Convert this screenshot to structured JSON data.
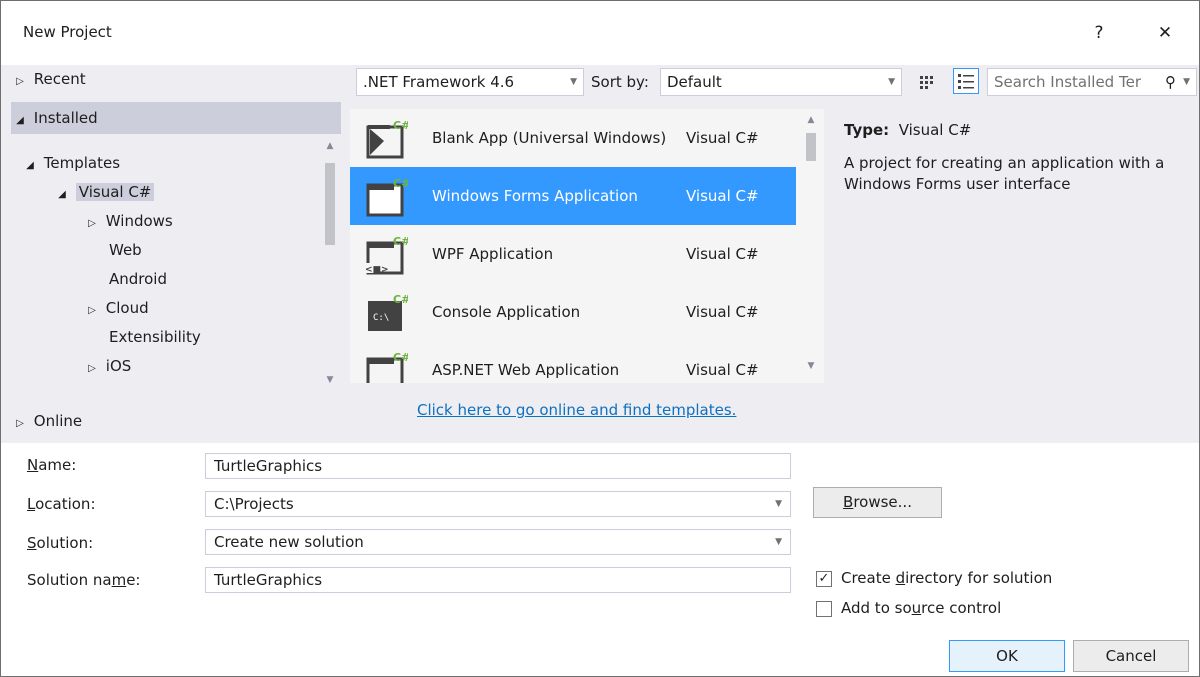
{
  "window": {
    "title": "New Project",
    "help_glyph": "?",
    "close_glyph": "✕"
  },
  "left_tree": {
    "recent": "Recent",
    "installed": "Installed",
    "templates": "Templates",
    "visual_csharp": "Visual C#",
    "children": [
      "Windows",
      "Web",
      "Android",
      "Cloud",
      "Extensibility",
      "iOS"
    ],
    "online": "Online"
  },
  "toolbar": {
    "framework": ".NET Framework 4.6",
    "sort_label": "Sort by:",
    "sort_value": "Default",
    "search_placeholder": "Search Installed Ter"
  },
  "templates": [
    {
      "name": "Blank App (Universal Windows)",
      "lang": "Visual C#",
      "icon": "blank-app-icon",
      "badge": "C#"
    },
    {
      "name": "Windows Forms Application",
      "lang": "Visual C#",
      "icon": "windows-forms-icon",
      "badge": "C#"
    },
    {
      "name": "WPF Application",
      "lang": "Visual C#",
      "icon": "wpf-icon",
      "badge": "C#"
    },
    {
      "name": "Console Application",
      "lang": "Visual C#",
      "icon": "console-icon",
      "badge": "C#",
      "console_text": "C:\\"
    },
    {
      "name": "ASP.NET Web Application",
      "lang": "Visual C#",
      "icon": "aspnet-icon",
      "badge": "C#"
    }
  ],
  "details": {
    "type_label": "Type:",
    "type_value": "Visual C#",
    "description": "A project for creating an application with a Windows Forms user interface"
  },
  "online_link": "Click here to go online and find templates.",
  "form": {
    "name_label_u": "N",
    "name_label_rest": "ame:",
    "name_value": "TurtleGraphics",
    "location_label_u": "L",
    "location_label_rest": "ocation:",
    "location_value": "C:\\Projects",
    "solution_label_u": "S",
    "solution_label_rest": "olution:",
    "solution_value": "Create new solution",
    "solution_name_label_a": "Solution na",
    "solution_name_label_u": "m",
    "solution_name_label_b": "e:",
    "solution_name_value": "TurtleGraphics",
    "browse_u": "B",
    "browse_rest": "rowse...",
    "create_dir_a": "Create ",
    "create_dir_u": "d",
    "create_dir_b": "irectory for solution",
    "create_dir_checked": true,
    "source_a": "Add to so",
    "source_u": "u",
    "source_b": "rce control",
    "source_checked": false,
    "ok": "OK",
    "cancel": "Cancel"
  },
  "colors": {
    "selection": "#3399ff",
    "tree_selection": "#cccedb",
    "link": "#0e70c0",
    "badge": "#6db33f",
    "dialog_bg": "#eeeef2"
  }
}
